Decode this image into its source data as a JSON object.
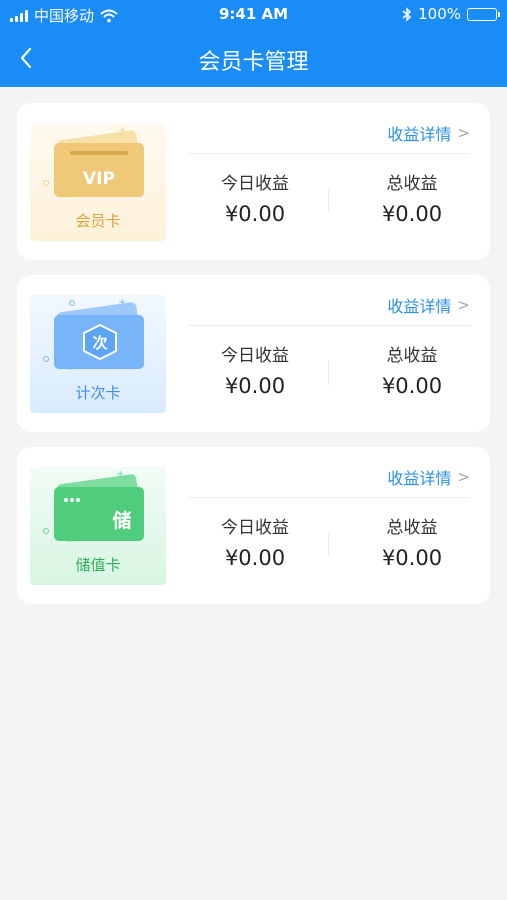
{
  "status_bar": {
    "carrier": "中国移动",
    "time": "9:41 AM",
    "battery": "100%",
    "battery_level": 1.0,
    "icons": [
      "signal-icon",
      "wifi-icon",
      "bluetooth-icon",
      "battery-icon"
    ]
  },
  "header": {
    "title": "会员卡管理",
    "back_icon": "chevron-left-icon",
    "background": "#1a8cf5"
  },
  "cards": [
    {
      "type_label": "会员卡",
      "badge_text": "VIP",
      "detail_link": "收益详情",
      "today_label": "今日收益",
      "today_value": "¥0.00",
      "total_label": "总收益",
      "total_value": "¥0.00",
      "accent": "#e7b451"
    },
    {
      "type_label": "计次卡",
      "badge_text": "次",
      "detail_link": "收益详情",
      "today_label": "今日收益",
      "today_value": "¥0.00",
      "total_label": "总收益",
      "total_value": "¥0.00",
      "accent": "#3f93f0"
    },
    {
      "type_label": "储值卡",
      "badge_text": "储",
      "detail_link": "收益详情",
      "today_label": "今日收益",
      "today_value": "¥0.00",
      "total_label": "总收益",
      "total_value": "¥0.00",
      "accent": "#2fb964"
    }
  ],
  "link_color": "#2b8ff0"
}
